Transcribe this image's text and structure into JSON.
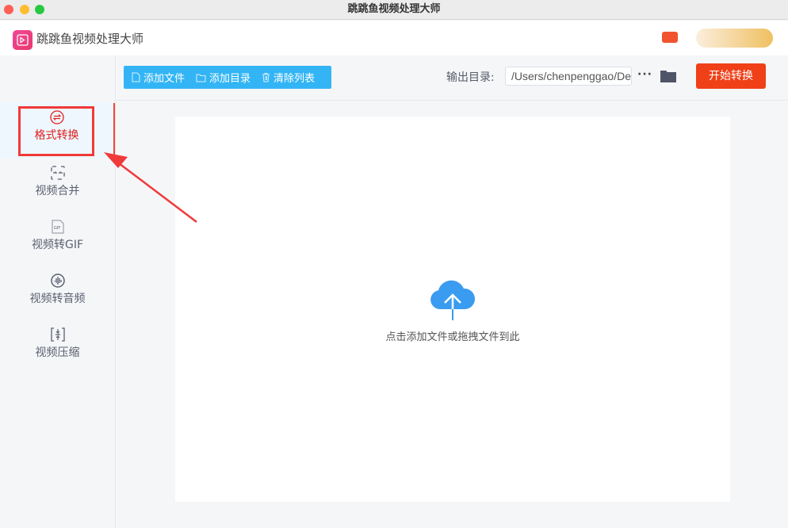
{
  "window": {
    "title": "跳跳鱼视频处理大师"
  },
  "header": {
    "app_title": "跳跳鱼视频处理大师"
  },
  "toolbar": {
    "add_file": "添加文件",
    "add_folder": "添加目录",
    "clear_list": "清除列表",
    "output_label": "输出目录:",
    "output_path": "/Users/chenpenggao/Desktop",
    "more": "···",
    "start": "开始转换"
  },
  "sidebar": {
    "items": [
      {
        "label": "格式转换",
        "icon": "format-convert-icon",
        "active": true
      },
      {
        "label": "视频合并",
        "icon": "merge-icon"
      },
      {
        "label": "视频转GIF",
        "icon": "gif-icon"
      },
      {
        "label": "视频转音频",
        "icon": "audio-icon"
      },
      {
        "label": "视频压缩",
        "icon": "compress-icon"
      }
    ]
  },
  "dropzone": {
    "text": "点击添加文件或拖拽文件到此"
  },
  "colors": {
    "accent": "#33b5f5",
    "start": "#f04018",
    "active": "#e02020",
    "annotation": "#f03a3a"
  }
}
